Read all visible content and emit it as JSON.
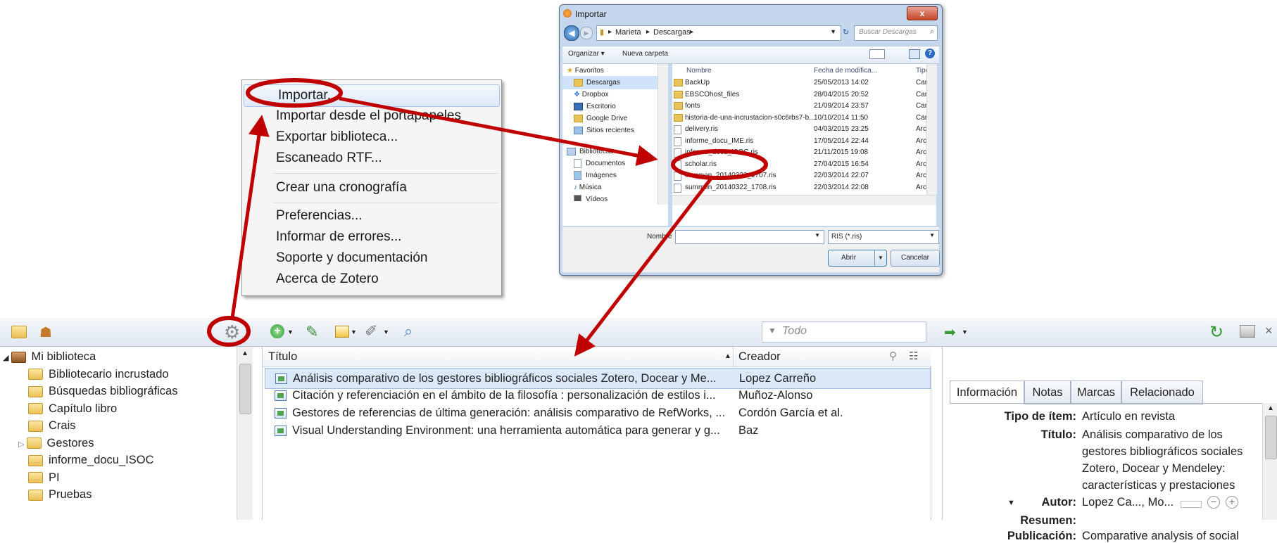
{
  "context_menu": {
    "items": [
      {
        "label": "Importar..."
      },
      {
        "label": "Importar desde el portapapeles"
      },
      {
        "label": "Exportar biblioteca..."
      },
      {
        "label": "Escaneado RTF..."
      },
      {
        "label": "Crear una cronografía"
      },
      {
        "label": "Preferencias..."
      },
      {
        "label": "Informar de errores..."
      },
      {
        "label": "Soporte y documentación"
      },
      {
        "label": "Acerca de Zotero"
      }
    ]
  },
  "dialog": {
    "title": "Importar",
    "close": "x",
    "breadcrumb": [
      "Marieta",
      "Descargas"
    ],
    "search_placeholder": "Buscar Descargas",
    "organize": "Organizar ▾",
    "new_folder": "Nueva carpeta",
    "nav": {
      "favorites": "Favoritos",
      "items": [
        "Descargas",
        "Dropbox",
        "Escritorio",
        "Google Drive",
        "Sitios recientes"
      ],
      "libraries": "Bibliotecas",
      "lib_items": [
        "Documentos",
        "Imágenes",
        "Música",
        "Vídeos"
      ]
    },
    "columns": {
      "name": "Nombre",
      "date": "Fecha de modifica...",
      "type": "Tipo"
    },
    "files": [
      {
        "name": "BackUp",
        "date": "25/05/2013 14:02",
        "type": "Carp",
        "kind": "folder"
      },
      {
        "name": "EBSCOhost_files",
        "date": "28/04/2015 20:52",
        "type": "Carp",
        "kind": "folder"
      },
      {
        "name": "fonts",
        "date": "21/09/2014 23:57",
        "type": "Carp",
        "kind": "folder"
      },
      {
        "name": "historia-de-una-incrustacion-s0c6rbs7-b...",
        "date": "10/10/2014 11:50",
        "type": "Carp",
        "kind": "folder"
      },
      {
        "name": "delivery.ris",
        "date": "04/03/2015 23:25",
        "type": "Arch",
        "kind": "doc"
      },
      {
        "name": "informe_docu_IME.ris",
        "date": "17/05/2014 22:44",
        "type": "Arch",
        "kind": "doc"
      },
      {
        "name": "informe_docu_ISOC.ris",
        "date": "21/11/2015 19:08",
        "type": "Arch",
        "kind": "doc"
      },
      {
        "name": "scholar.ris",
        "date": "27/04/2015 16:54",
        "type": "Arch",
        "kind": "doc"
      },
      {
        "name": "summon_20140322_1707.ris",
        "date": "22/03/2014 22:07",
        "type": "Arch",
        "kind": "doc"
      },
      {
        "name": "summon_20140322_1708.ris",
        "date": "22/03/2014 22:08",
        "type": "Arch",
        "kind": "doc"
      }
    ],
    "filename_label": "Nombre",
    "filter": "RIS (*.ris)",
    "open_label": "Abrir",
    "cancel_label": "Cancelar"
  },
  "zotero": {
    "search_placeholder": "Todo",
    "collections": [
      {
        "label": "Mi biblioteca",
        "root": true
      },
      {
        "label": "Bibliotecario incrustado"
      },
      {
        "label": "Búsquedas bibliográficas"
      },
      {
        "label": "Capítulo libro"
      },
      {
        "label": "Crais"
      },
      {
        "label": "Gestores"
      },
      {
        "label": "informe_docu_ISOC"
      },
      {
        "label": "PI"
      },
      {
        "label": "Pruebas"
      }
    ],
    "columns": {
      "title": "Título",
      "creator": "Creador"
    },
    "items": [
      {
        "title": "Análisis comparativo de los gestores bibliográficos sociales Zotero, Docear y Me...",
        "creator": "Lopez Carreño"
      },
      {
        "title": "Citación y referenciación en el ámbito de la filosofía : personalización de estilos i...",
        "creator": "Muñoz-Alonso"
      },
      {
        "title": "Gestores de referencias de última generación: análisis comparativo de RefWorks, ...",
        "creator": "Cordón García et al."
      },
      {
        "title": "Visual Understanding Environment: una herramienta automática para generar y g...",
        "creator": "Baz"
      }
    ],
    "tabs": [
      "Información",
      "Notas",
      "Marcas",
      "Relacionado"
    ],
    "info": {
      "item_type_label": "Tipo de ítem:",
      "item_type": "Artículo en revista",
      "title_label": "Título:",
      "title_lines": [
        "Análisis comparativo de los",
        "gestores bibliográficos sociales",
        "Zotero, Docear y Mendeley:",
        "características y prestaciones"
      ],
      "author_label": "Autor:",
      "author": "Lopez Ca..., Mo...",
      "abstract_label": "Resumen:",
      "publication_label": "Publicación:",
      "publication": "Comparative analysis of social"
    }
  },
  "colors": {
    "annotation": "#c00000",
    "selection": "#dbe8f8"
  }
}
